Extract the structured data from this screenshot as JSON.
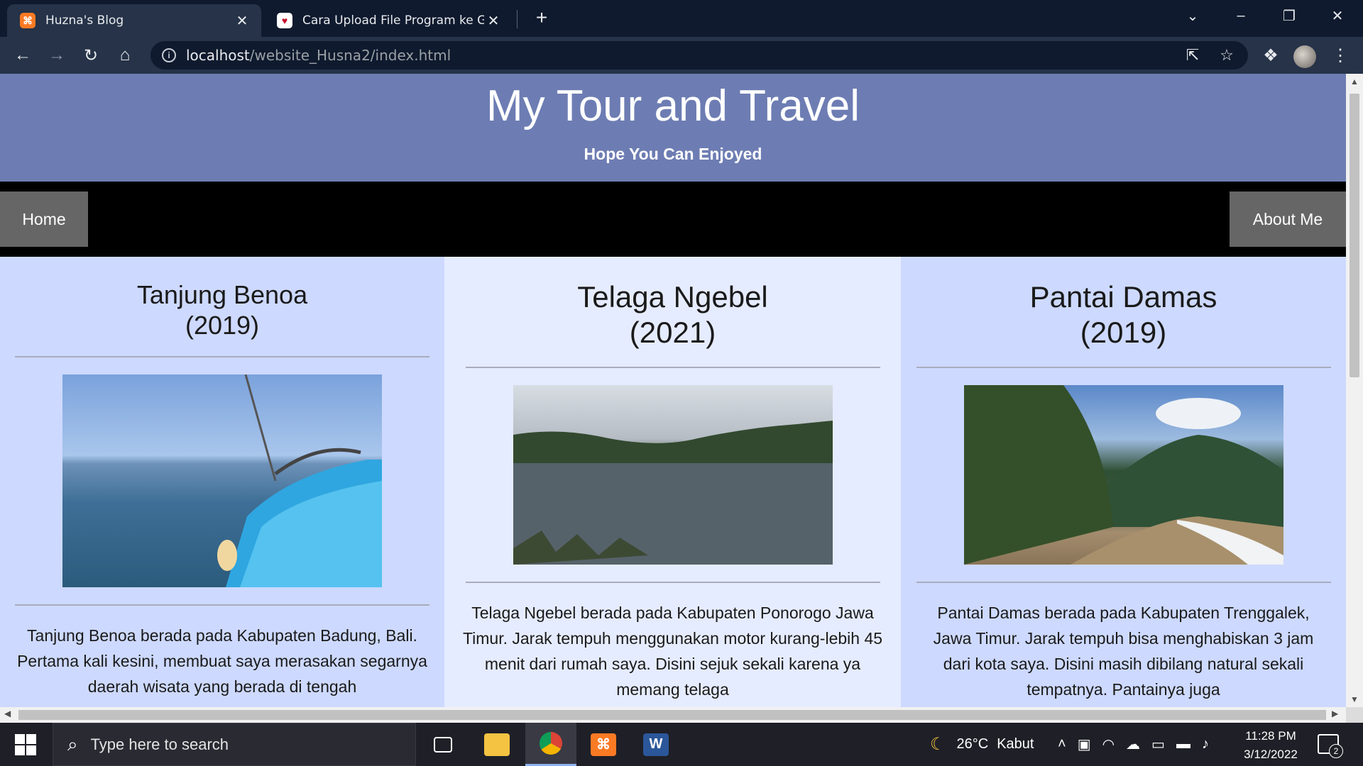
{
  "browser": {
    "tabs": [
      {
        "title": "Huzna's Blog",
        "favicon": "xampp-icon",
        "active": true
      },
      {
        "title": "Cara Upload File Program ke GitHub",
        "favicon": "heart-icon",
        "active": false
      }
    ],
    "new_tab_symbol": "+",
    "url_host": "localhost",
    "url_path": "/website_Husna2/index.html"
  },
  "site": {
    "title": "My Tour and Travel",
    "tagline": "Hope You Can Enjoyed",
    "nav": {
      "home": "Home",
      "about": "About Me"
    },
    "destinations": [
      {
        "title_line1": "Tanjung Benoa",
        "title_line2": "(2019)",
        "image": "boat-sea-photo",
        "text": "Tanjung Benoa berada pada Kabupaten Badung, Bali. Pertama kali kesini, membuat saya merasakan segarnya daerah wisata yang berada di tengah"
      },
      {
        "title_line1": "Telaga Ngebel",
        "title_line2": "(2021)",
        "image": "lake-photo",
        "text": "Telaga Ngebel berada pada Kabupaten Ponorogo Jawa Timur. Jarak tempuh menggunakan motor kurang-lebih 45 menit dari rumah saya. Disini sejuk sekali karena ya memang telaga"
      },
      {
        "title_line1": "Pantai Damas",
        "title_line2": "(2019)",
        "image": "beach-mountain-photo",
        "text": "Pantai Damas berada pada Kabupaten Trenggalek, Jawa Timur. Jarak tempuh bisa menghabiskan 3 jam dari kota saya. Disini masih dibilang natural sekali tempatnya. Pantainya juga"
      }
    ]
  },
  "taskbar": {
    "search_placeholder": "Type here to search",
    "weather_temp": "26°C",
    "weather_desc": "Kabut",
    "time": "11:28 PM",
    "date": "3/12/2022",
    "notification_count": "2"
  },
  "colors": {
    "header_bg": "#6d7db3",
    "nav_bg": "#000000",
    "nav_link_bg": "#666666",
    "page_bg": "#cdd9ff",
    "mid_column_bg": "#e6ecff"
  }
}
